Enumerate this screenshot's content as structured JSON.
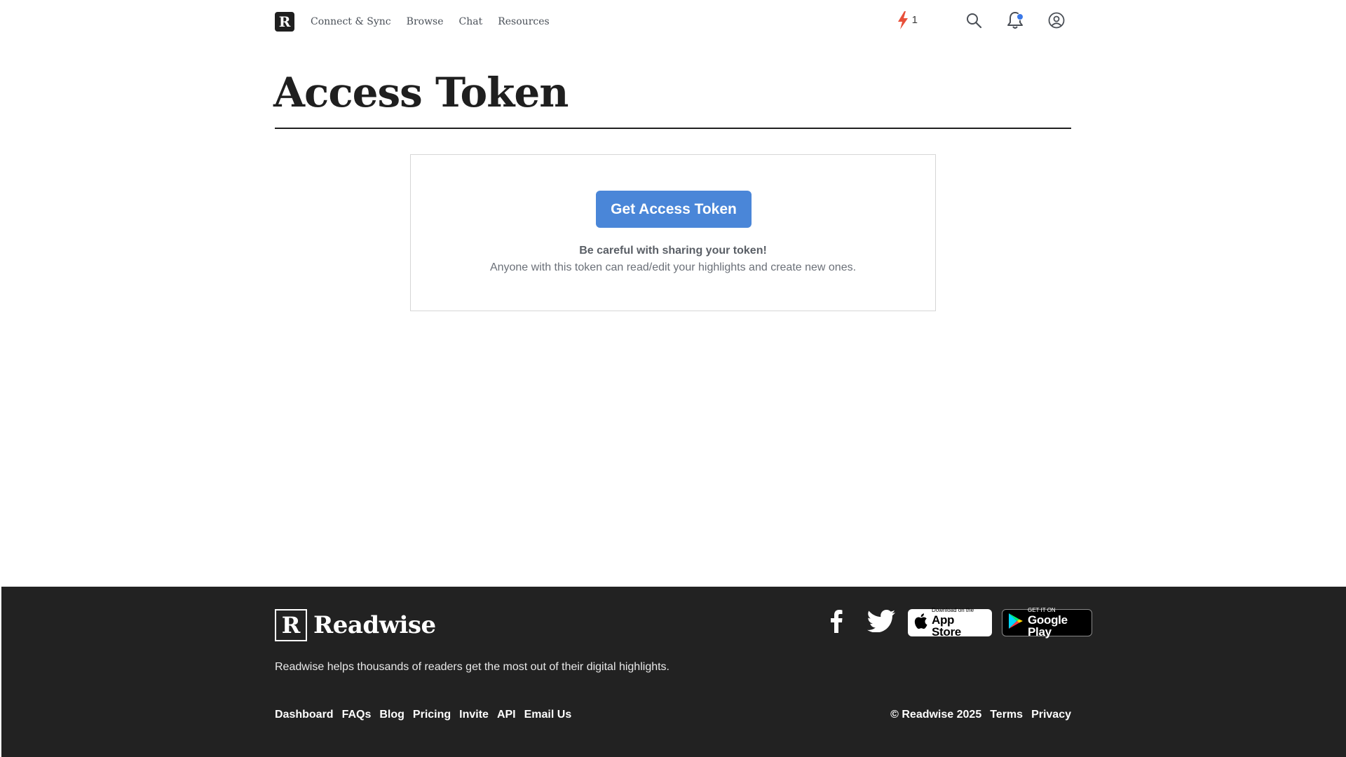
{
  "header": {
    "logo_letter": "R",
    "nav": [
      "Connect & Sync",
      "Browse",
      "Chat",
      "Resources"
    ],
    "streak_count": "1",
    "icons": [
      "lightning-icon",
      "search-icon",
      "bell-icon",
      "user-icon"
    ],
    "has_unread_notification": true
  },
  "page": {
    "title": "Access Token"
  },
  "token_card": {
    "button_label": "Get Access Token",
    "warning_title": "Be careful with sharing your token!",
    "warning_text": "Anyone with this token can read/edit your highlights and create new ones."
  },
  "footer": {
    "logo_letter": "R",
    "brand": "Readwise",
    "tagline": "Readwise helps thousands of readers get the most out of their digital highlights.",
    "app_store": {
      "small": "Download on the",
      "big": "App Store"
    },
    "google_play": {
      "small": "GET IT ON",
      "big": "Google Play"
    },
    "links": [
      "Dashboard",
      "FAQs",
      "Blog",
      "Pricing",
      "Invite",
      "API",
      "Email Us"
    ],
    "copyright": "© Readwise 2025",
    "terms": "Terms",
    "privacy": "Privacy"
  },
  "colors": {
    "primary_button": "#4a86d8",
    "footer_bg": "#222222",
    "streak_accent": "#e8503a",
    "notification_dot": "#3b78e7"
  }
}
